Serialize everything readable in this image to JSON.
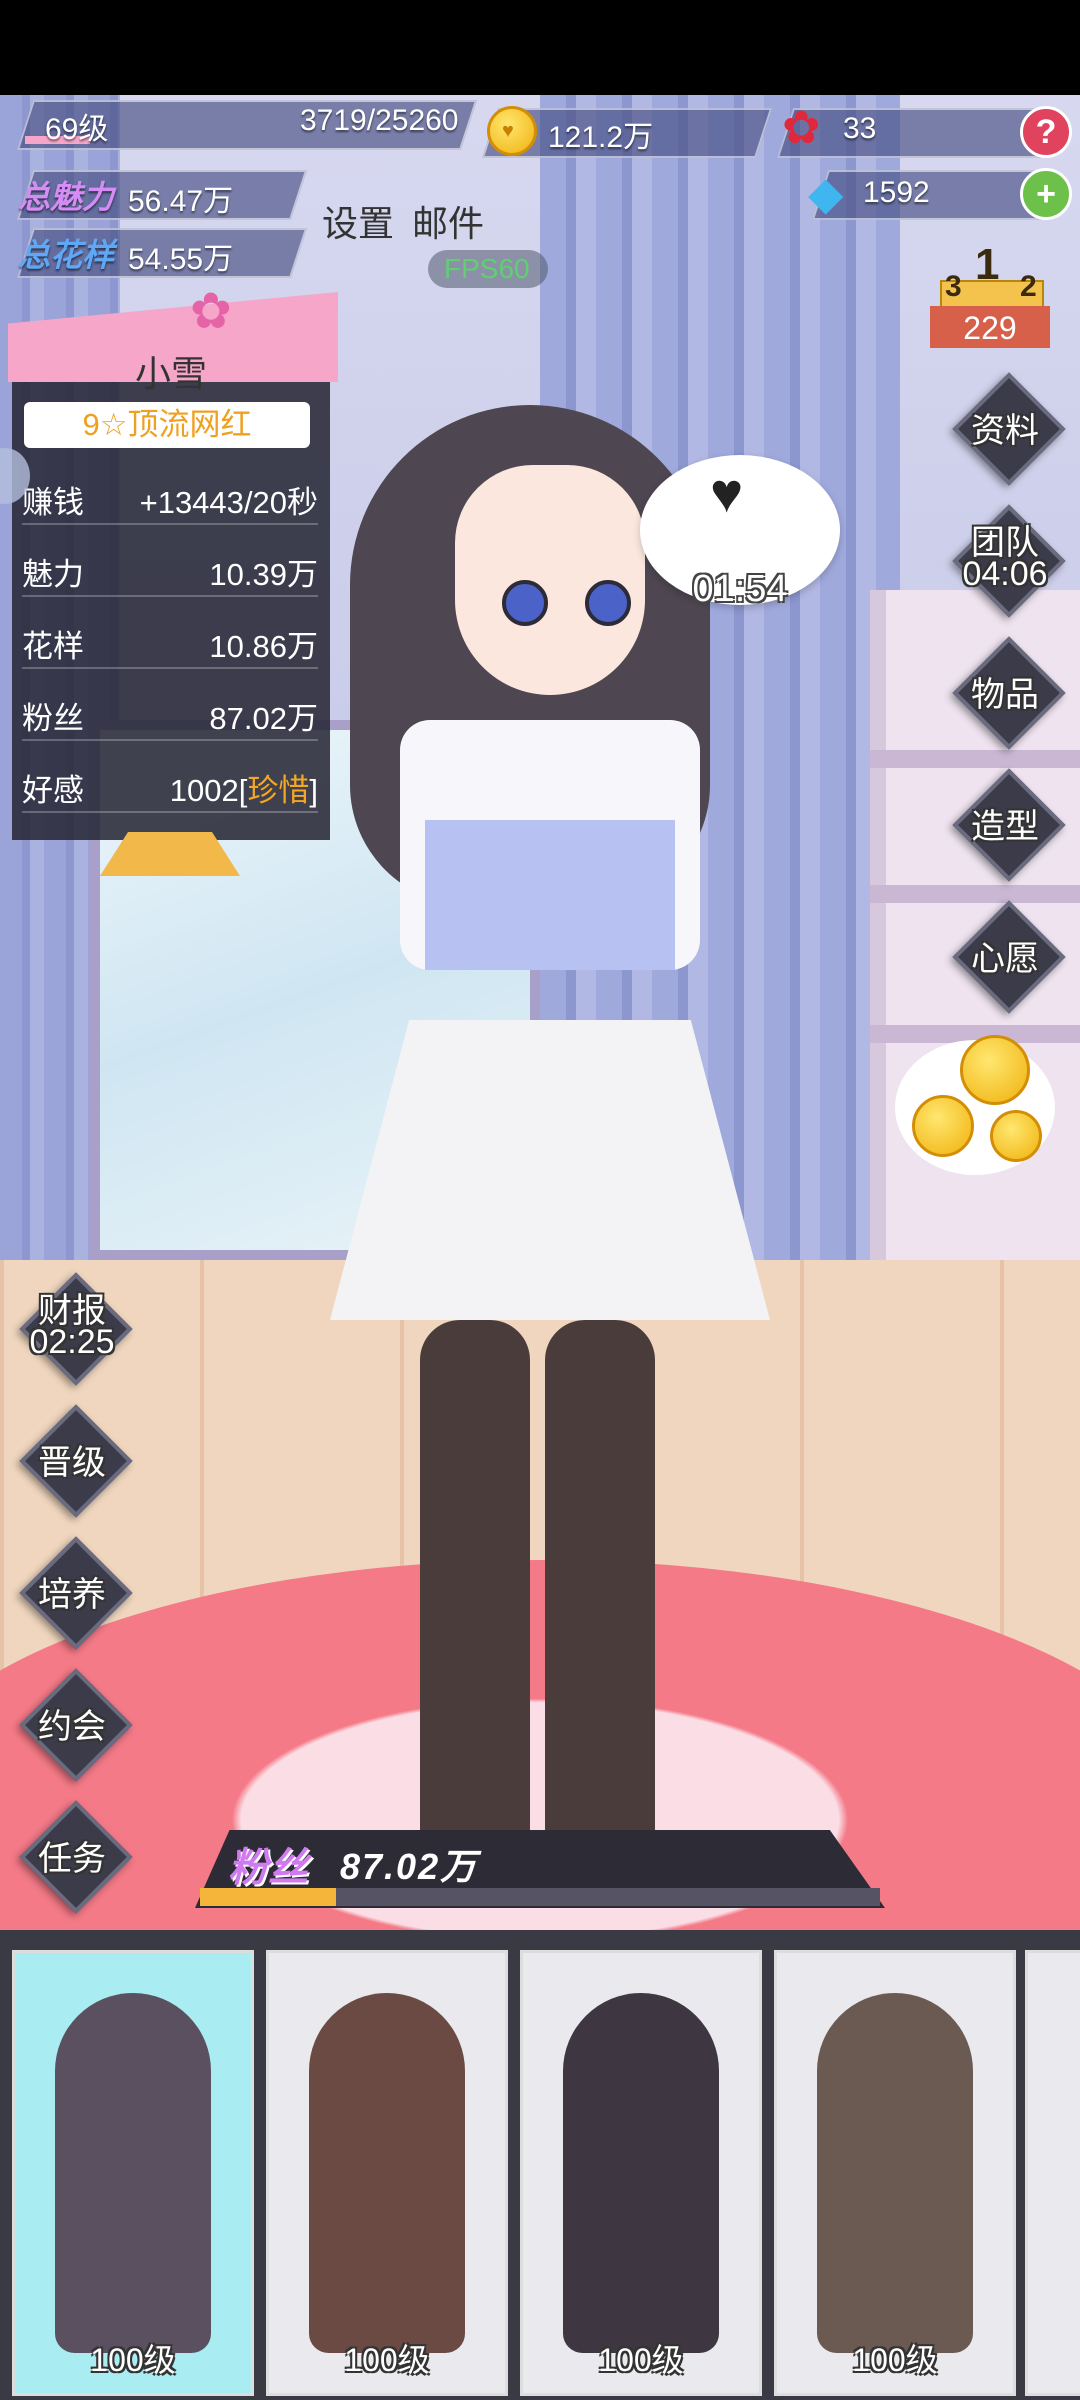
{
  "hud": {
    "level": "69级",
    "exp": "3719/25260",
    "exp_fraction": 0.147,
    "coins": "121.2万",
    "roses": "33",
    "gems": "1592",
    "help": "?",
    "add": "+",
    "charm_label": "总魅力",
    "charm_value": "56.47万",
    "style_label": "总花样",
    "style_value": "54.55万",
    "settings": "设置",
    "mail": "邮件",
    "fps": "FPS60",
    "podium_1": "1",
    "podium_2": "2",
    "podium_3": "3",
    "rank": "229"
  },
  "character": {
    "name": "小雪",
    "title": "9☆顶流网红",
    "stats": [
      {
        "label": "赚钱",
        "value": "+13443/20秒"
      },
      {
        "label": "魅力",
        "value": "10.39万"
      },
      {
        "label": "花样",
        "value": "10.86万"
      },
      {
        "label": "粉丝",
        "value": "87.02万"
      },
      {
        "label": "好感",
        "value": "1002[",
        "highlight": "珍惜",
        "suffix": "]"
      }
    ],
    "bubble_timer": "01:54"
  },
  "right_menu": [
    {
      "label": "资料"
    },
    {
      "label": "团队",
      "sub": "04:06"
    },
    {
      "label": "物品"
    },
    {
      "label": "造型"
    },
    {
      "label": "心愿"
    }
  ],
  "left_menu": [
    {
      "label": "财报",
      "sub": "02:25"
    },
    {
      "label": "晋级"
    },
    {
      "label": "培养"
    },
    {
      "label": "约会"
    },
    {
      "label": "任务"
    }
  ],
  "fans": {
    "label": "粉丝",
    "value": "87.02万",
    "progress": 0.2
  },
  "cards": [
    {
      "level": "100级",
      "color": "#a9ecf2"
    },
    {
      "level": "100级",
      "color": "#e9e9ee"
    },
    {
      "level": "100级",
      "color": "#e9e9ee"
    },
    {
      "level": "100级",
      "color": "#e9e9ee"
    }
  ],
  "colors": {
    "accent_gold": "#f5a623",
    "fans_purple": "#d07af0",
    "panel_bg": "#282837",
    "rug": "#f47a87"
  }
}
